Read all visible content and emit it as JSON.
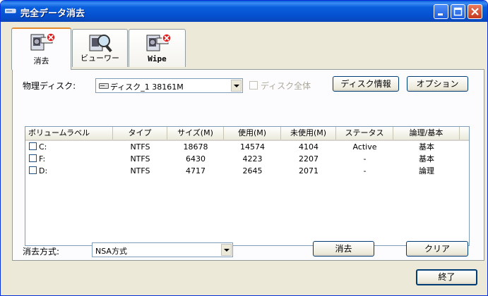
{
  "window": {
    "title": "完全データ消去"
  },
  "tabs": [
    {
      "label": "消去",
      "icon": "erase-disk-icon"
    },
    {
      "label": "ビューワー",
      "icon": "viewer-magnifier-icon"
    },
    {
      "label": "Wipe",
      "icon": "wipe-disk-icon"
    }
  ],
  "disk": {
    "label": "物理ディスク:",
    "selected": "ディスク_1  38161M",
    "whole_disk_label": "ディスク全体",
    "info_button": "ディスク情報",
    "option_button": "オプション"
  },
  "table": {
    "columns": [
      "ボリュームラベル",
      "タイプ",
      "サイズ(M)",
      "使用(M)",
      "未使用(M)",
      "ステータス",
      "論理/基本"
    ],
    "rows": [
      {
        "label": "C:",
        "type": "NTFS",
        "size": "18678",
        "used": "14574",
        "free": "4104",
        "status": "Active",
        "kind": "基本"
      },
      {
        "label": "F:",
        "type": "NTFS",
        "size": "6430",
        "used": "4223",
        "free": "2207",
        "status": "-",
        "kind": "基本"
      },
      {
        "label": "D:",
        "type": "NTFS",
        "size": "4717",
        "used": "2645",
        "free": "2071",
        "status": "-",
        "kind": "論理"
      }
    ]
  },
  "method": {
    "label": "消去方式:",
    "selected": "NSA方式",
    "erase_button": "消去",
    "clear_button": "クリア"
  },
  "footer": {
    "exit_button": "終了"
  },
  "colors": {
    "titlebar": "#0a5fdc",
    "face": "#ece9d8",
    "tab_highlight": "#e68b2c"
  }
}
